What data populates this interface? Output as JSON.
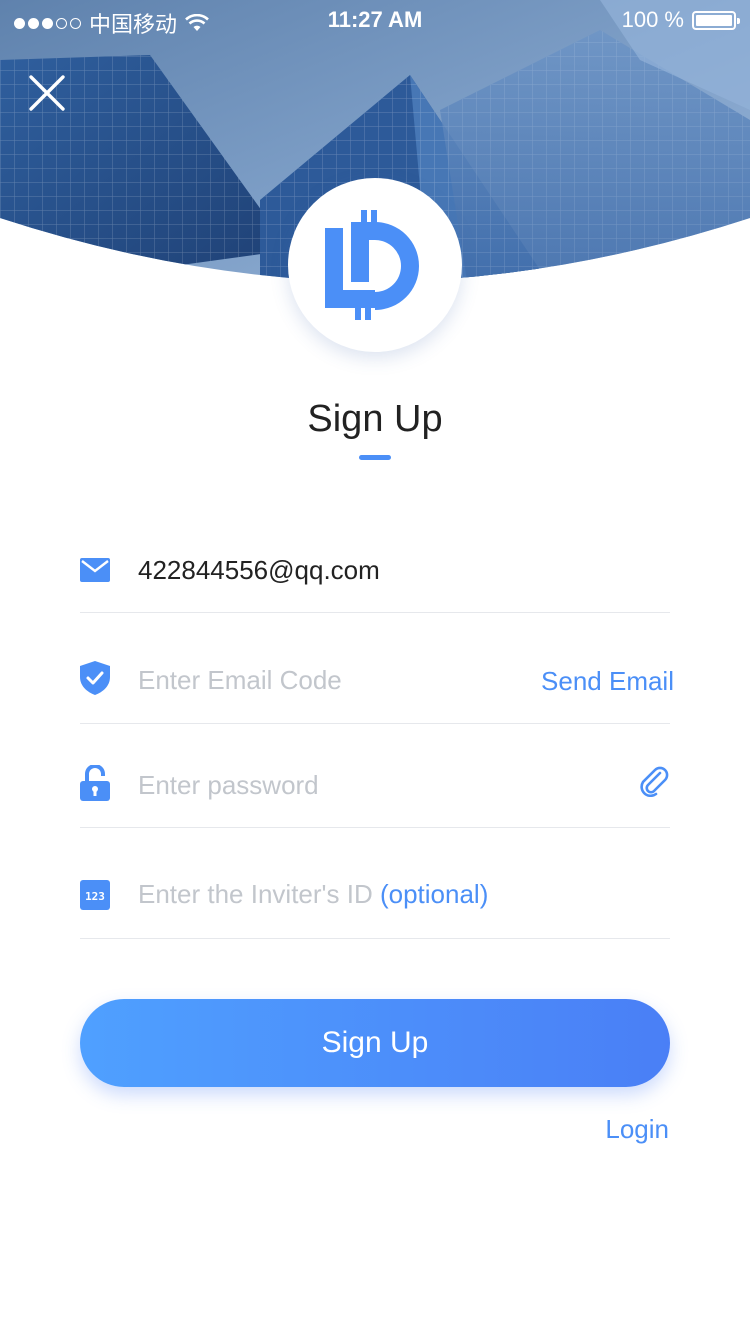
{
  "status_bar": {
    "carrier": "中国移动",
    "time": "11:27 AM",
    "battery": "100 %"
  },
  "icons": {
    "close": "close-icon",
    "email": "mail-icon",
    "code": "shield-check-icon",
    "password": "unlock-icon",
    "show_password": "paperclip-icon",
    "inviter": "number-123-icon"
  },
  "header": {
    "title": "Sign Up"
  },
  "form": {
    "email": {
      "value": "422844556@qq.com"
    },
    "code": {
      "placeholder": "Enter Email Code",
      "action": "Send Email"
    },
    "password": {
      "placeholder": "Enter password"
    },
    "inviter": {
      "placeholder": "Enter the Inviter's ID",
      "optional": "(optional)"
    }
  },
  "buttons": {
    "submit": "Sign Up",
    "login": "Login"
  },
  "colors": {
    "accent": "#4b8ff7",
    "text": "#222222",
    "placeholder": "#c2c6cc",
    "divider": "#e6e8ec"
  }
}
